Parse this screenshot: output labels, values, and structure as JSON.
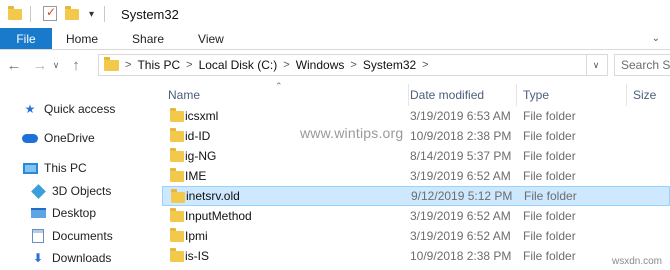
{
  "window": {
    "title": "System32",
    "quick_access_icons": [
      "folder-icon",
      "properties-icon",
      "new-folder-icon"
    ]
  },
  "ribbon": {
    "tabs": [
      "File",
      "Home",
      "Share",
      "View"
    ]
  },
  "address": {
    "crumbs": [
      "This PC",
      "Local Disk (C:)",
      "Windows",
      "System32"
    ],
    "separator": ">"
  },
  "search": {
    "placeholder": "Search Sy"
  },
  "nav_pane": {
    "items": [
      {
        "label": "Quick access",
        "icon": "star-icon"
      },
      {
        "label": "OneDrive",
        "icon": "cloud-icon"
      },
      {
        "label": "This PC",
        "icon": "computer-icon"
      },
      {
        "label": "3D Objects",
        "icon": "cube-icon"
      },
      {
        "label": "Desktop",
        "icon": "desktop-icon"
      },
      {
        "label": "Documents",
        "icon": "documents-icon"
      },
      {
        "label": "Downloads",
        "icon": "download-icon"
      }
    ]
  },
  "columns": {
    "name": "Name",
    "date": "Date modified",
    "type": "Type",
    "size": "Size"
  },
  "files": [
    {
      "name": "icsxml",
      "date": "3/19/2019 6:53 AM",
      "type": "File folder",
      "selected": false
    },
    {
      "name": "id-ID",
      "date": "10/9/2018 2:38 PM",
      "type": "File folder",
      "selected": false
    },
    {
      "name": "ig-NG",
      "date": "8/14/2019 5:37 PM",
      "type": "File folder",
      "selected": false
    },
    {
      "name": "IME",
      "date": "3/19/2019 6:52 AM",
      "type": "File folder",
      "selected": false
    },
    {
      "name": "inetsrv.old",
      "date": "9/12/2019 5:12 PM",
      "type": "File folder",
      "selected": true
    },
    {
      "name": "InputMethod",
      "date": "3/19/2019 6:52 AM",
      "type": "File folder",
      "selected": false
    },
    {
      "name": "Ipmi",
      "date": "3/19/2019 6:52 AM",
      "type": "File folder",
      "selected": false
    },
    {
      "name": "is-IS",
      "date": "10/9/2018 2:38 PM",
      "type": "File folder",
      "selected": false
    }
  ],
  "watermark": "www.wintips.org",
  "credit": "wsxdn.com",
  "colors": {
    "accent": "#1979ca",
    "selection": "#cde8ff",
    "folder": "#f3c94b"
  }
}
